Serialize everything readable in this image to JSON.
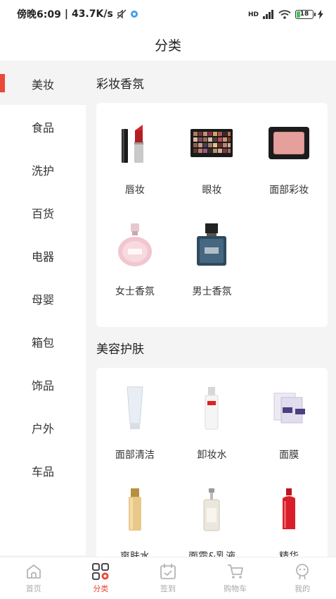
{
  "status": {
    "time": "傍晚6:09",
    "speed": "43.7K/s",
    "network": "HD",
    "battery": "18"
  },
  "header": {
    "title": "分类"
  },
  "sidebar": {
    "items": [
      {
        "label": "美妆"
      },
      {
        "label": "食品"
      },
      {
        "label": "洗护"
      },
      {
        "label": "百货"
      },
      {
        "label": "电器"
      },
      {
        "label": "母婴"
      },
      {
        "label": "箱包"
      },
      {
        "label": "饰品"
      },
      {
        "label": "户外"
      },
      {
        "label": "车品"
      }
    ]
  },
  "sections": [
    {
      "title": "彩妆香氛",
      "items": [
        {
          "label": "唇妆",
          "icon": "lipstick-icon"
        },
        {
          "label": "眼妆",
          "icon": "eyeshadow-palette-icon"
        },
        {
          "label": "面部彩妆",
          "icon": "blush-compact-icon"
        },
        {
          "label": "女士香氛",
          "icon": "womens-perfume-icon"
        },
        {
          "label": "男士香氛",
          "icon": "mens-perfume-icon"
        }
      ]
    },
    {
      "title": "美容护肤",
      "items": [
        {
          "label": "面部清洁",
          "icon": "cleanser-tube-icon"
        },
        {
          "label": "卸妆水",
          "icon": "toner-bottle-icon"
        },
        {
          "label": "面膜",
          "icon": "face-mask-icon"
        },
        {
          "label": "爽肤水",
          "icon": "gold-bottle-icon"
        },
        {
          "label": "面霜&乳液",
          "icon": "pump-bottle-icon"
        },
        {
          "label": "精华",
          "icon": "red-serum-icon"
        }
      ]
    }
  ],
  "tabbar": {
    "items": [
      {
        "label": "首页",
        "icon": "home-icon"
      },
      {
        "label": "分类",
        "icon": "category-icon"
      },
      {
        "label": "签到",
        "icon": "calendar-checkin-icon"
      },
      {
        "label": "购物车",
        "icon": "cart-icon"
      },
      {
        "label": "我的",
        "icon": "profile-icon"
      }
    ]
  },
  "colors": {
    "accent": "#e84a3a",
    "background": "#f4f4f4"
  }
}
